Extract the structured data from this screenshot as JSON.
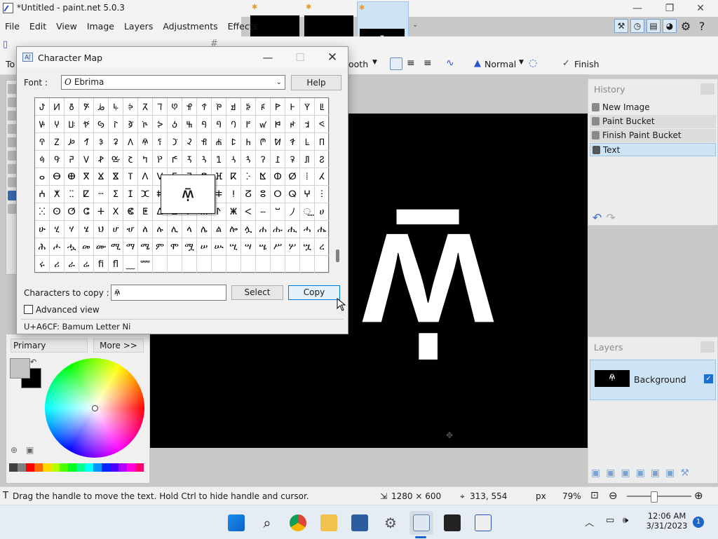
{
  "app": {
    "title": "*Untitled - paint.net 5.0.3",
    "window_buttons": [
      "—",
      "❐",
      "✕"
    ],
    "menu": [
      "File",
      "Edit",
      "View",
      "Image",
      "Layers",
      "Adjustments",
      "Effects"
    ],
    "doc_thumb_glyph": "ꛏ"
  },
  "toolbar": {
    "antialias_label": "ooth",
    "blend_mode": "Normal",
    "finish_label": "Finish",
    "tools_prefix": "To"
  },
  "canvas": {
    "glyph": "ꛏ",
    "background": "#000000",
    "foreground": "#ffffff"
  },
  "colors": {
    "mode": "Primary",
    "more_button": "More >>",
    "primary": "#c3c3c3",
    "secondary": "#000000",
    "palette": [
      "#404040",
      "#808080",
      "#ff0000",
      "#ff6a00",
      "#ffd800",
      "#b6ff00",
      "#4cff00",
      "#00ff21",
      "#00ff90",
      "#00ffff",
      "#0094ff",
      "#0026ff",
      "#4800ff",
      "#b200ff",
      "#ff00dc",
      "#ff006e"
    ]
  },
  "history": {
    "title": "History",
    "items": [
      "New Image",
      "Paint Bucket",
      "Finish Paint Bucket",
      "Text"
    ]
  },
  "layers": {
    "title": "Layers",
    "items": [
      {
        "name": "Background",
        "visible": true
      }
    ]
  },
  "status": {
    "hint": "Drag the handle to move the text. Hold Ctrl to hide handle and cursor.",
    "size": "1280 × 600",
    "pos": "313, 554",
    "unit": "px",
    "zoom": "79%"
  },
  "taskbar": {
    "time": "12:06 AM",
    "date": "3/31/2023",
    "notification_count": "1"
  },
  "charmap": {
    "title": "Character Map",
    "font_label": "Font :",
    "font_value": "Ebrima",
    "help": "Help",
    "chars": [
      "ꚠ",
      "ꚡ",
      "ꚢ",
      "ꚣ",
      "ꚤ",
      "ꚥ",
      "ꚦ",
      "ꚧ",
      "ꚨ",
      "ꚩ",
      "ꚪ",
      "ꚫ",
      "ꚬ",
      "ꚭ",
      "ꚮ",
      "ꚯ",
      "ꚰ",
      "ꚱ",
      "ꚲ",
      "ꚳ",
      "ꚴ",
      "ꚵ",
      "ꚶ",
      "ꚷ",
      "ꚸ",
      "ꚹ",
      "ꚺ",
      "ꚻ",
      "ꚼ",
      "ꚽ",
      "ꚾ",
      "ꚿ",
      "ꛀ",
      "ꛁ",
      "ꛂ",
      "ꛃ",
      "ꛄ",
      "ꛅ",
      "ꛆ",
      "ꛇ",
      "ꛈ",
      "ꛉ",
      "ꛊ",
      "ꛋ",
      "ꛌ",
      "ꛍ",
      "ꛎ",
      "ꛏ",
      "ꛐ",
      "ꛑ",
      "ꛒ",
      "ꛓ",
      "ꛔ",
      "ꛕ",
      "ꛖ",
      "ꛗ",
      "ꛘ",
      "ꛙ",
      "ꛚ",
      "ꛛ",
      "ꛜ",
      "ꛝ",
      "ꛞ",
      "ꛟ",
      "ꛠ",
      "ꛡ",
      "ꛢ",
      "ꛣ",
      "ꛤ",
      "ꛥ",
      "ꛦ",
      "ꛧ",
      "ꛨ",
      "ꛩ",
      "ꛪ",
      "ꛫ",
      "ꛬ",
      "ꛭ",
      "ꛮ",
      "ꛯ",
      "ⴰ",
      "ⴱ",
      "ⴲ",
      "ⴳ",
      "ⴴ",
      "ⴵ",
      "ⴶ",
      "ⴷ",
      "ⴸ",
      "ⴹ",
      "ⴺ",
      "ⴻ",
      "ⴼ",
      "ⴽ",
      "ⴾ",
      "ⴿ",
      "ⵀ",
      "ⵁ",
      "ⵂ",
      "ⵃ",
      "ⵄ",
      "ⵅ",
      "ⵆ",
      "ⵇ",
      "ⵈ",
      "ⵉ",
      "ⵊ",
      "ⵋ",
      "ⵌ",
      "ⵍ",
      "ⵎ",
      "ⵏ",
      "ⵐ",
      "ⵑ",
      "ⵒ",
      "ⵓ",
      "ⵔ",
      "ⵕ",
      "ⵖ",
      "ⵗ",
      "ⵘ",
      "ⵙ",
      "ⵚ",
      "ⵛ",
      "ⵜ",
      "ⵝ",
      "ⵞ",
      "ⵟ",
      "ⵠ",
      "ⵡ",
      "ⵢ",
      "ⵣ",
      "ⵤ",
      "ⵥ",
      "ⵦ",
      "ⵧ",
      "ⵯ",
      "⵰",
      "⵿",
      "ሀ",
      "ሁ",
      "ሂ",
      "ሃ",
      "ሄ",
      "ህ",
      "ሆ",
      "ሇ",
      "ለ",
      "ሉ",
      "ሊ",
      "ላ",
      "ሌ",
      "ል",
      "ሎ",
      "ሏ",
      "ሐ",
      "ሑ",
      "ሒ",
      "ሓ",
      "ሔ",
      "ሕ",
      "ሖ",
      "ሗ",
      "መ",
      "ሙ",
      "ሚ",
      "ማ",
      "ሜ",
      "ም",
      "ሞ",
      "ሟ",
      "ሠ",
      "ሡ",
      "ሢ",
      "ሣ",
      "ሤ",
      "ሥ",
      "ሦ",
      "ሧ",
      "ረ",
      "ሩ",
      "ሪ",
      "ራ",
      "ሬ",
      "ﬁ",
      "ﬂ",
      "﹏",
      "﹌",
      "",
      "",
      "",
      "",
      "",
      "",
      "",
      "",
      "",
      "",
      "",
      ""
    ],
    "magnified": "ꛏ",
    "copy_label": "Characters to copy :",
    "copy_value": "ꛏ",
    "select": "Select",
    "copy": "Copy",
    "advanced": "Advanced view",
    "status": "U+A6CF: Bamum Letter Ni"
  }
}
